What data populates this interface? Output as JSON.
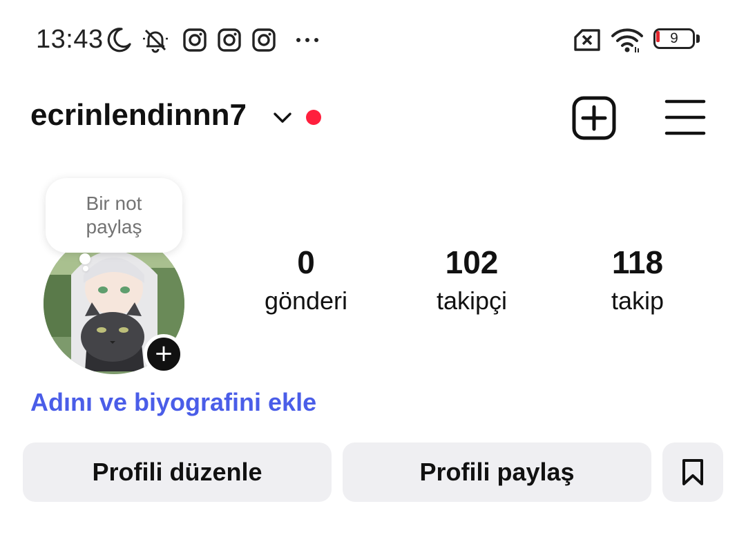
{
  "status_bar": {
    "time": "13:43",
    "icons": [
      "moon-icon",
      "bell-muted-icon",
      "instagram-icon",
      "instagram-icon",
      "instagram-icon",
      "more-dots-icon",
      "sim-none-icon",
      "wifi-icon"
    ],
    "battery_level": "9",
    "battery_color": "#e0242b"
  },
  "header": {
    "username": "ecrinlendinnn7",
    "chevron_icon": "chevron-down-icon",
    "notification_dot_color": "#ff1f3d",
    "add_icon": "add-square-icon",
    "menu_icon": "hamburger-menu-icon"
  },
  "note": {
    "text": "Bir not paylaş"
  },
  "avatar": {
    "add_story_symbol": "+"
  },
  "stats": [
    {
      "value": "0",
      "label": "gönderi"
    },
    {
      "value": "102",
      "label": "takipçi"
    },
    {
      "value": "118",
      "label": "takip"
    }
  ],
  "bio_link": {
    "text": "Adını ve biyografini ekle",
    "color": "#4a5de8"
  },
  "buttons": {
    "edit_profile": "Profili düzenle",
    "share_profile": "Profili paylaş",
    "saved_icon": "bookmark-icon"
  }
}
